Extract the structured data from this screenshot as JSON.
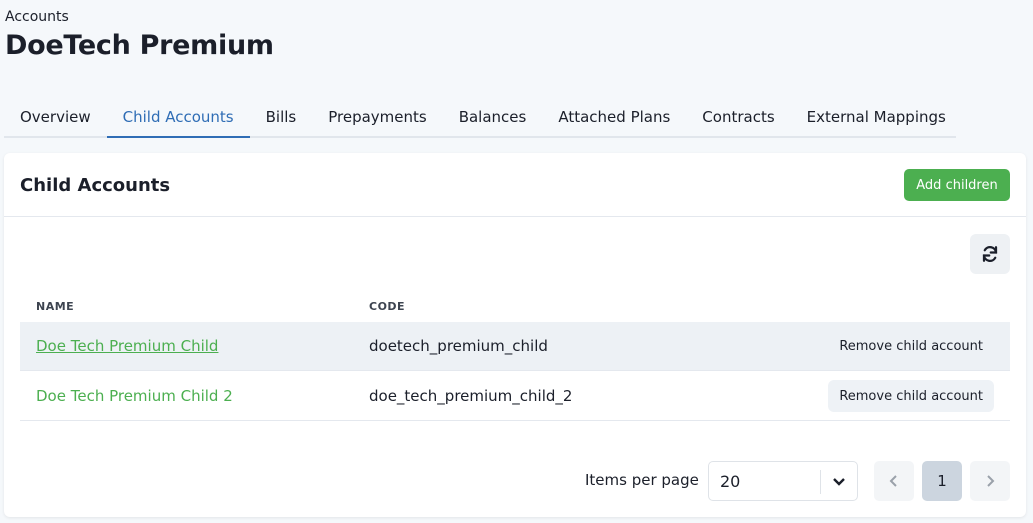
{
  "breadcrumb": "Accounts",
  "title": "DoeTech Premium",
  "tabs": [
    {
      "label": "Overview"
    },
    {
      "label": "Child Accounts"
    },
    {
      "label": "Bills"
    },
    {
      "label": "Prepayments"
    },
    {
      "label": "Balances"
    },
    {
      "label": "Attached Plans"
    },
    {
      "label": "Contracts"
    },
    {
      "label": "External Mappings"
    }
  ],
  "active_tab": "Child Accounts",
  "card": {
    "title": "Child Accounts",
    "add_label": "Add children"
  },
  "table": {
    "headers": {
      "name": "NAME",
      "code": "CODE"
    },
    "rows": [
      {
        "name": "Doe Tech Premium Child",
        "code": "doetech_premium_child",
        "action": "Remove child account"
      },
      {
        "name": "Doe Tech Premium Child 2",
        "code": "doe_tech_premium_child_2",
        "action": "Remove child account"
      }
    ]
  },
  "pagination": {
    "items_per_page_label": "Items per page",
    "items_per_page": "20",
    "current_page": "1"
  },
  "colors": {
    "accent": "#2f6db5",
    "green": "#4caf50"
  }
}
